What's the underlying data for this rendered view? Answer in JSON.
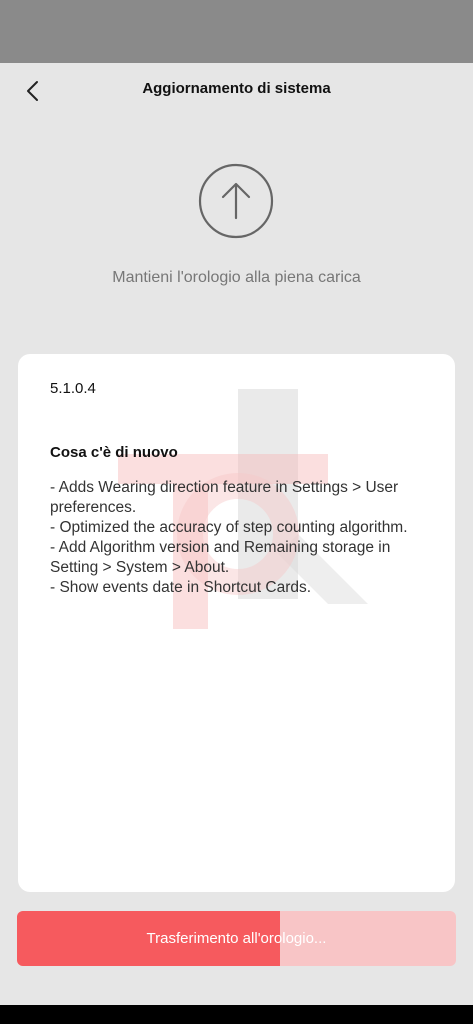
{
  "header": {
    "title": "Aggiornamento di sistema",
    "back_icon": "chevron-left-icon"
  },
  "update": {
    "icon": "arrow-up-circle-icon",
    "hint": "Mantieni l'orologio alla piena carica"
  },
  "card": {
    "version": "5.1.0.4",
    "whats_new_title": "Cosa c'è di nuovo",
    "notes": [
      "- Adds Wearing direction feature in Settings > User preferences.",
      "- Optimized the accuracy of step counting algorithm.",
      "- Add Algorithm version and Remaining storage in Setting > System > About.",
      "- Show events date in Shortcut Cards."
    ]
  },
  "transfer": {
    "label": "Trasferimento all'orologio...",
    "progress": 0.6
  },
  "colors": {
    "accent": "#f65a5e",
    "accent_light": "#f8c5c6",
    "background": "#e6e6e6"
  }
}
